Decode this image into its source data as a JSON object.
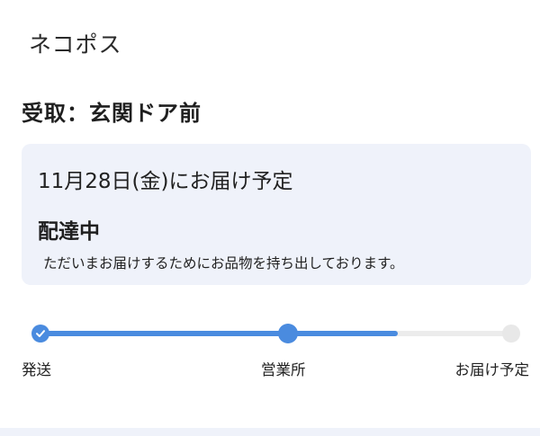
{
  "service": {
    "name": "ネコポス"
  },
  "receipt": {
    "label": "受取：玄関ドア前"
  },
  "delivery": {
    "eta": "11月28日(金)にお届け予定",
    "status": "配達中",
    "message": "ただいまお届けするためにお品物を持ち出しております。"
  },
  "tracker": {
    "steps": [
      {
        "label": "発送",
        "state": "done"
      },
      {
        "label": "営業所",
        "state": "current"
      },
      {
        "label": "お届け予定",
        "state": "pending"
      }
    ],
    "progress_percent": 76
  },
  "colors": {
    "accent": "#4a8bdf",
    "card_bg": "#eff2fa",
    "track_inactive": "#ececec",
    "node_inactive": "#e8e8e8"
  }
}
